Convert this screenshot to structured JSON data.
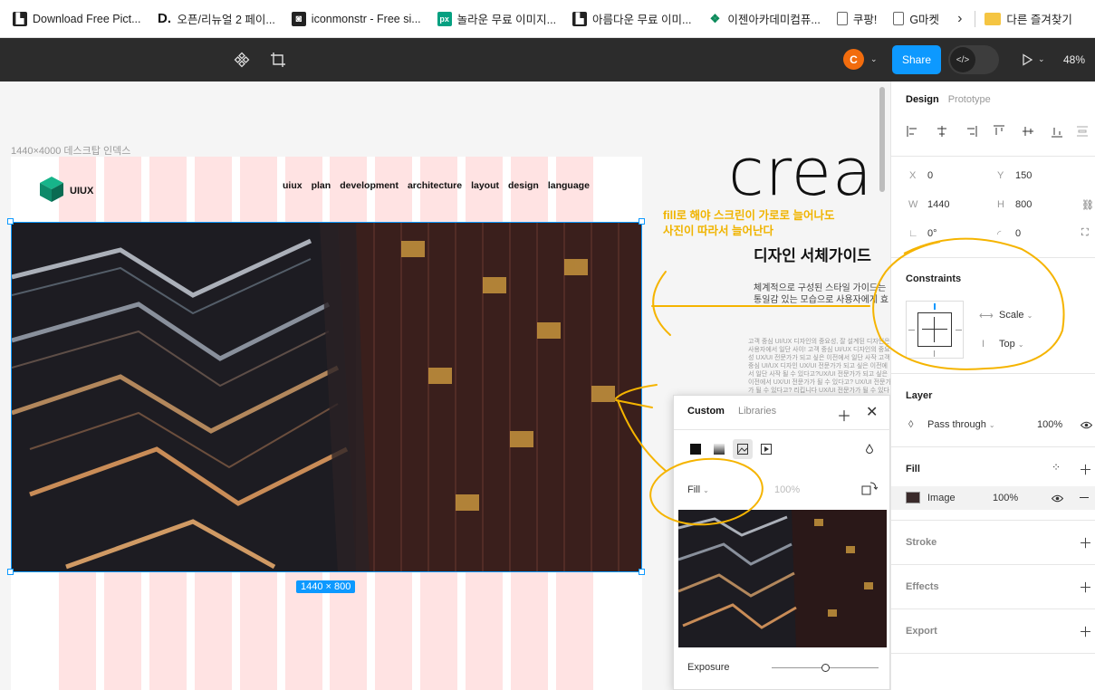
{
  "bookmarks": [
    {
      "label": "Download Free Pict...",
      "icon": "person-photo-icon",
      "color": "#222"
    },
    {
      "label": "오픈/리뉴얼 2 페이...",
      "icon": "d-letter-icon",
      "color": "#111"
    },
    {
      "label": "iconmonstr - Free si...",
      "icon": "iconmonstr-icon",
      "color": "#222"
    },
    {
      "label": "놀라운 무료 이미지...",
      "icon": "px-icon",
      "color": "#05a081"
    },
    {
      "label": "아름다운 무료 이미...",
      "icon": "person-photo-icon",
      "color": "#222"
    },
    {
      "label": "이젠아카데미컴퓨...",
      "icon": "ezen-icon",
      "color": "#0a8a5a"
    },
    {
      "label": "쿠팡!",
      "icon": "page-icon",
      "color": "#666"
    },
    {
      "label": "G마켓",
      "icon": "page-icon",
      "color": "#666"
    }
  ],
  "bookmarks_more": "›",
  "bookmarks_folder": "다른 즐겨찾기",
  "toolbar": {
    "avatar_initial": "C",
    "share_label": "Share",
    "code_label": "</>",
    "zoom": "48%"
  },
  "canvas": {
    "frame_label": "1440×4000 데스크탑 인덱스",
    "logo_text": "UIUX",
    "nav": [
      "uiux",
      "plan",
      "development",
      "architecture",
      "layout",
      "design",
      "language"
    ],
    "dimension_badge": "1440 × 800",
    "hero_word": "crea",
    "guide_title": "디자인 서체가이드",
    "guide_text_1": "체계적으로 구성된 스타일 가이드는",
    "guide_text_2": "통일감 있는 모습으로 사용자에게 효",
    "small_text": "고객 중심 UI/UX 디자인의 중요성, 잘 설계된 디자인은 사용자에서 일단 사이! 고객 중심 UI/UX 디자인의 중요성 UX/UI 전문가가 되고 싶은 이전에서 일단 사작 고객 중심 UI/UX 디자인 UX/UI 전문가가 되고 싶은 이전에서 일단 사작 될 수 있다고?UX/UI 전문가가 되고 싶은 이전에서 UX/UI 전문가가 될 수 있다고? UX/UI 전문가가 될 수 있다고? 리킵니다 UX/UI 전문가가 될 수 있다고",
    "note_line_1": "fill로 해야 스크린이 가로로 늘어나도",
    "note_line_2": "사진이 따라서 늘어난다"
  },
  "fill_popup": {
    "tab_custom": "Custom",
    "tab_libraries": "Libraries",
    "fill_mode": "Fill",
    "opacity": "100%",
    "exposure_label": "Exposure",
    "exposure_value": 0.5
  },
  "panel": {
    "tab_design": "Design",
    "tab_prototype": "Prototype",
    "x_label": "X",
    "x_value": "0",
    "y_label": "Y",
    "y_value": "150",
    "w_label": "W",
    "w_value": "1440",
    "h_label": "H",
    "h_value": "800",
    "rotation": "0°",
    "radius": "0",
    "constraints_title": "Constraints",
    "constraint_h": "Scale",
    "constraint_v": "Top",
    "layer_title": "Layer",
    "blend_mode": "Pass through",
    "layer_opacity": "100%",
    "fill_title": "Fill",
    "fill_type": "Image",
    "fill_opacity": "100%",
    "stroke_title": "Stroke",
    "effects_title": "Effects",
    "export_title": "Export"
  },
  "colors": {
    "accent": "#0d99ff",
    "annotation": "#f5b400",
    "grid_column": "#ffe3e3"
  }
}
